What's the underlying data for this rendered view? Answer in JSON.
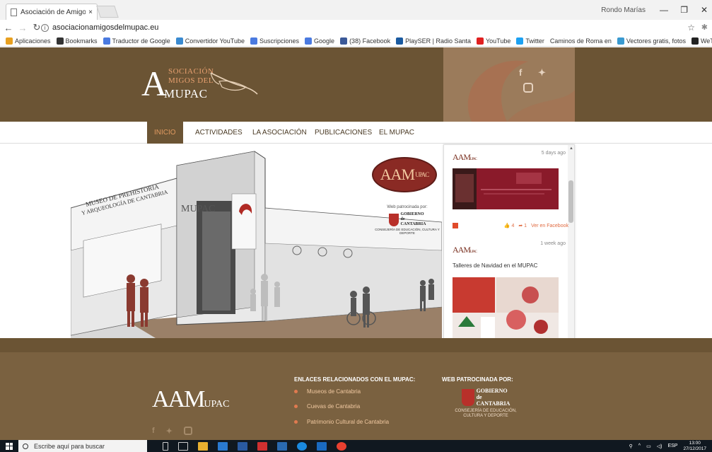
{
  "browser": {
    "tab_title": "Asociación de Amigos de",
    "tab_close": "×",
    "user_name": "Rondo Marías",
    "url": "asociacionamigosdelmupac.eu",
    "bookmarks": [
      {
        "label": "Aplicaciones",
        "icon": "apps-icon",
        "color": "#e8a020"
      },
      {
        "label": "Bookmarks",
        "icon": "star-icon",
        "color": "#333333"
      },
      {
        "label": "Traductor de Google",
        "icon": "translate-icon",
        "color": "#4a7ae0"
      },
      {
        "label": "Convertidor YouTube",
        "icon": "convert-icon",
        "color": "#3a8ad0"
      },
      {
        "label": "Suscripciones",
        "icon": "google-icon",
        "color": "#4a7ae0"
      },
      {
        "label": "Google",
        "icon": "google-icon",
        "color": "#4a7ae0"
      },
      {
        "label": "(38) Facebook",
        "icon": "facebook-icon",
        "color": "#3b5998"
      },
      {
        "label": "PlaySER | Radio Santa",
        "icon": "radio-icon",
        "color": "#1a5aa0"
      },
      {
        "label": "YouTube",
        "icon": "youtube-icon",
        "color": "#e02020"
      },
      {
        "label": "Twitter",
        "icon": "twitter-icon",
        "color": "#1da1f2"
      },
      {
        "label": "Caminos de Roma en",
        "icon": "",
        "color": ""
      },
      {
        "label": "Vectores gratis, fotos",
        "icon": "vector-icon",
        "color": "#3a9ad0"
      },
      {
        "label": "WeTransfer",
        "icon": "wetransfer-icon",
        "color": "#222222"
      }
    ]
  },
  "site": {
    "logo": {
      "big_a": "A",
      "line1": "SOCIACIÓN",
      "line2": "MIGOS DEL",
      "line3": "UPAC",
      "line3_prefix": "M"
    },
    "nav": [
      "INICIO",
      "ACTIVIDADES",
      "LA ASOCIACIÓN",
      "PUBLICACIONES",
      "EL MUPAC"
    ],
    "sponsor": {
      "aam": "AAM",
      "aam_sub": "UPAC",
      "web_label": "Web patrocinada por:",
      "gobierno_1": "GOBIERNO",
      "gobierno_2": "de",
      "gobierno_3": "CANTABRIA",
      "consejeria": "CONSEJERÍA DE EDUCACIÓN, CULTURA Y DEPORTE"
    },
    "facebook_widget": {
      "posts": [
        {
          "time": "5 days ago",
          "likes": "4",
          "shares": "1",
          "view": "Ver en Facebook"
        },
        {
          "time": "1 week ago",
          "title": "Talleres de Navidad en el MUPAC"
        }
      ]
    },
    "footer": {
      "logo": "AAM",
      "logo_sub": "UPAC",
      "links_title": "ENLACES RELACIONADOS CON EL MUPAC:",
      "links": [
        "Museos de Cantabria",
        "Cuevas de Cantabria",
        "Patrimonio Cultural de Cantabria"
      ],
      "sponsor_title": "WEB PATROCINADA POR:",
      "gobierno_1": "GOBIERNO",
      "gobierno_2": "de",
      "gobierno_3": "CANTABRIA",
      "consejeria": "CONSEJERÍA DE EDUCACIÓN, CULTURA Y DEPORTE"
    }
  },
  "taskbar": {
    "search_placeholder": "Escribe aquí para buscar",
    "lang": "ESP",
    "time": "13:00",
    "date": "27/12/2017"
  },
  "colors": {
    "brown_dark": "#6b5434",
    "accent": "#e07a50",
    "footer": "#7a6140"
  }
}
